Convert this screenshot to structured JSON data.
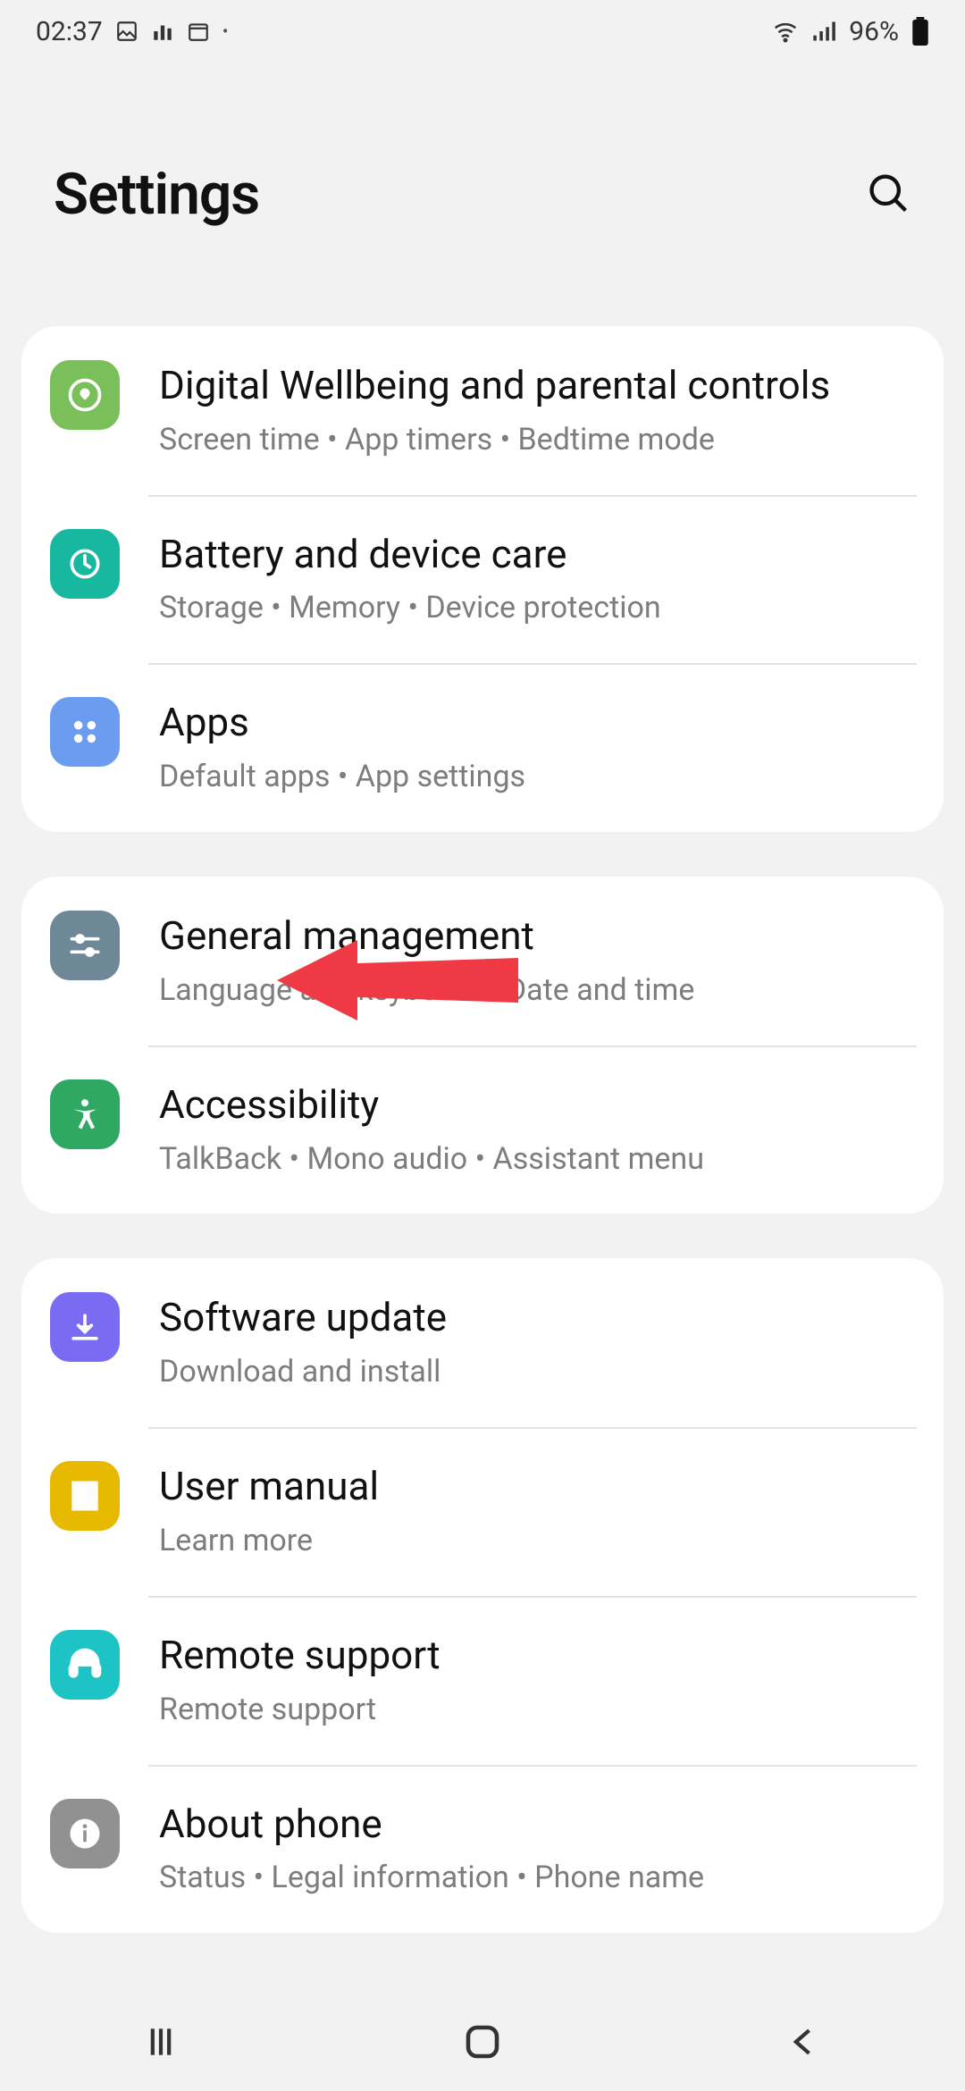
{
  "status": {
    "time": "02:37",
    "battery": "96%"
  },
  "header": {
    "title": "Settings"
  },
  "groups": [
    {
      "rows": [
        {
          "icon": "wellbeing",
          "title": "Digital Wellbeing and parental controls",
          "sub": "Screen time  •  App timers  •  Bedtime mode"
        },
        {
          "icon": "care",
          "title": "Battery and device care",
          "sub": "Storage  •  Memory  •  Device protection"
        },
        {
          "icon": "apps",
          "title": "Apps",
          "sub": "Default apps  •  App settings",
          "annotated": true
        }
      ]
    },
    {
      "rows": [
        {
          "icon": "general",
          "title": "General management",
          "sub": "Language and keyboard  •  Date and time"
        },
        {
          "icon": "accessibility",
          "title": "Accessibility",
          "sub": "TalkBack  •  Mono audio  •  Assistant menu"
        }
      ]
    },
    {
      "rows": [
        {
          "icon": "update",
          "title": "Software update",
          "sub": "Download and install"
        },
        {
          "icon": "manual",
          "title": "User manual",
          "sub": "Learn more"
        },
        {
          "icon": "support",
          "title": "Remote support",
          "sub": "Remote support"
        },
        {
          "icon": "about",
          "title": "About phone",
          "sub": "Status  •  Legal information  •  Phone name"
        }
      ]
    }
  ]
}
